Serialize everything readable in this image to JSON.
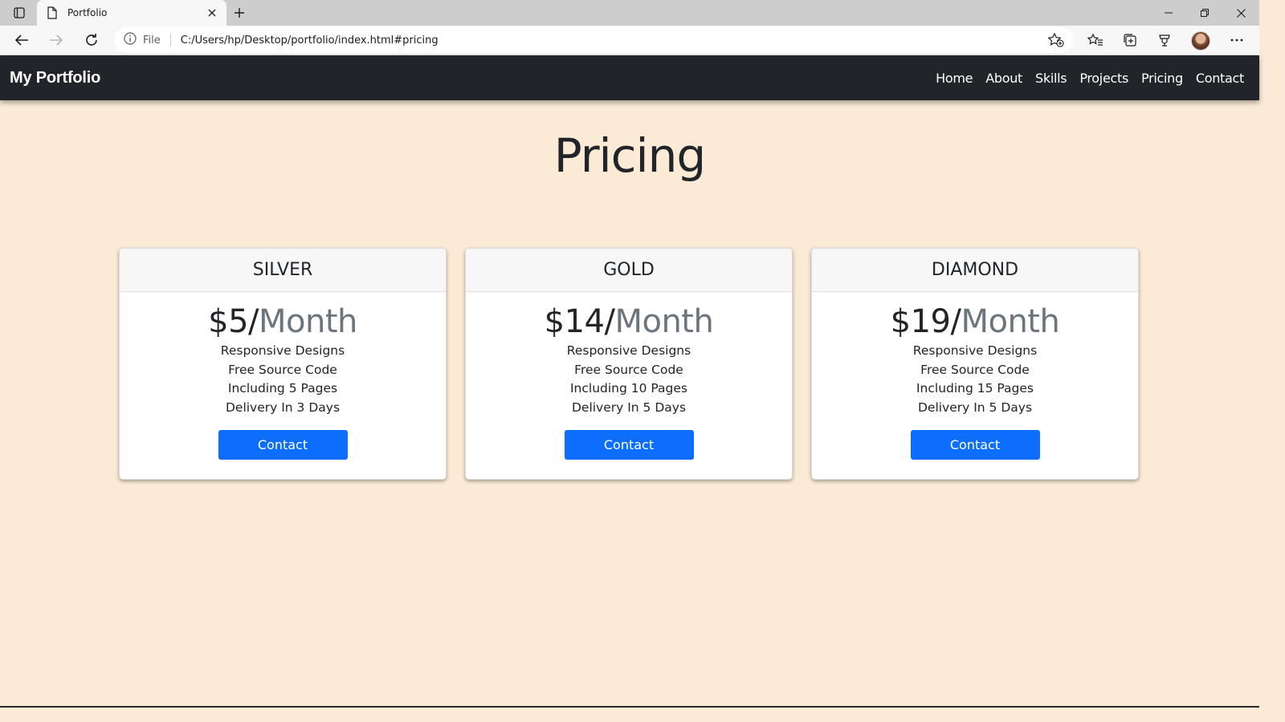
{
  "browser": {
    "tab_title": "Portfolio",
    "file_label": "File",
    "url": "C:/Users/hp/Desktop/portfolio/index.html#pricing"
  },
  "site": {
    "brand": "My Portfolio",
    "nav": [
      {
        "label": "Home"
      },
      {
        "label": "About"
      },
      {
        "label": "Skills"
      },
      {
        "label": "Projects"
      },
      {
        "label": "Pricing"
      },
      {
        "label": "Contact"
      }
    ]
  },
  "pricing": {
    "title": "Pricing",
    "plans": [
      {
        "name": "SILVER",
        "price": "$5/",
        "period": "Month",
        "features": [
          "Responsive Designs",
          "Free Source Code",
          "Including 5 Pages",
          "Delivery In 3 Days"
        ],
        "button": "Contact"
      },
      {
        "name": "GOLD",
        "price": "$14/",
        "period": "Month",
        "features": [
          "Responsive Designs",
          "Free Source Code",
          "Including 10 Pages",
          "Delivery In 5 Days"
        ],
        "button": "Contact"
      },
      {
        "name": "DIAMOND",
        "price": "$19/",
        "period": "Month",
        "features": [
          "Responsive Designs",
          "Free Source Code",
          "Including 15 Pages",
          "Delivery In 5 Days"
        ],
        "button": "Contact"
      }
    ]
  },
  "colors": {
    "page_background": "#fbebd6",
    "navbar": "#212529",
    "button": "#0d6efd",
    "muted_text": "#6c757d"
  }
}
